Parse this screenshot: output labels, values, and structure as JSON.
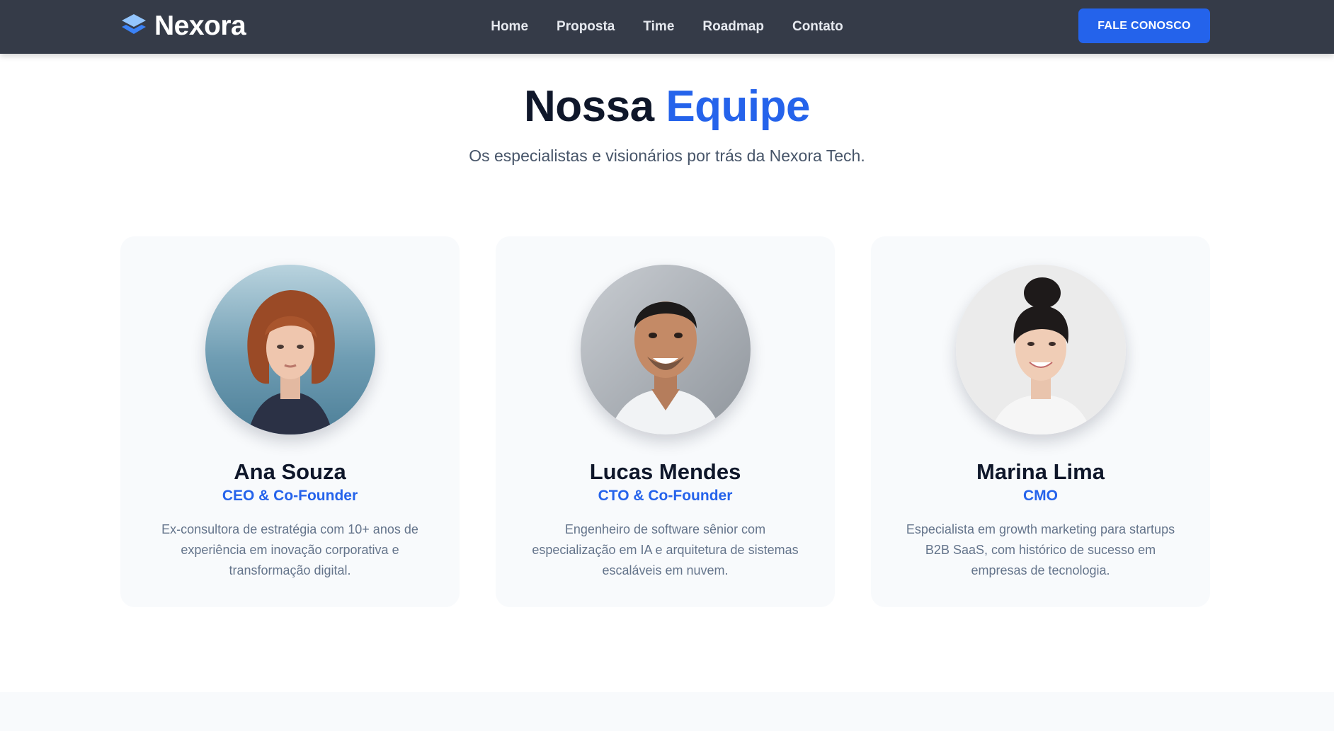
{
  "navbar": {
    "brand_name": "Nexora",
    "brand_icon": "layers-icon",
    "links": [
      {
        "label": "Home"
      },
      {
        "label": "Proposta"
      },
      {
        "label": "Time"
      },
      {
        "label": "Roadmap"
      },
      {
        "label": "Contato"
      }
    ],
    "cta_label": "FALE CONOSCO"
  },
  "hero": {
    "title_main": "Nossa",
    "title_accent": "Equipe",
    "subtitle": "Os especialistas e visionários por trás da Nexora Tech."
  },
  "team": [
    {
      "name": "Ana Souza",
      "role": "CEO & Co-Founder",
      "bio": "Ex-consultora de estratégia com 10+ anos de experiência em inovação corporativa e transformação digital."
    },
    {
      "name": "Lucas Mendes",
      "role": "CTO & Co-Founder",
      "bio": "Engenheiro de software sênior com especialização em IA e arquitetura de sistemas escaláveis em nuvem."
    },
    {
      "name": "Marina Lima",
      "role": "CMO",
      "bio": "Especialista em growth marketing para startups B2B SaaS, com histórico de sucesso em empresas de tecnologia."
    }
  ],
  "colors": {
    "navbar_bg": "#353b48",
    "accent": "#2563eb",
    "heading": "#0f172a",
    "card_bg": "#f8fafc"
  }
}
